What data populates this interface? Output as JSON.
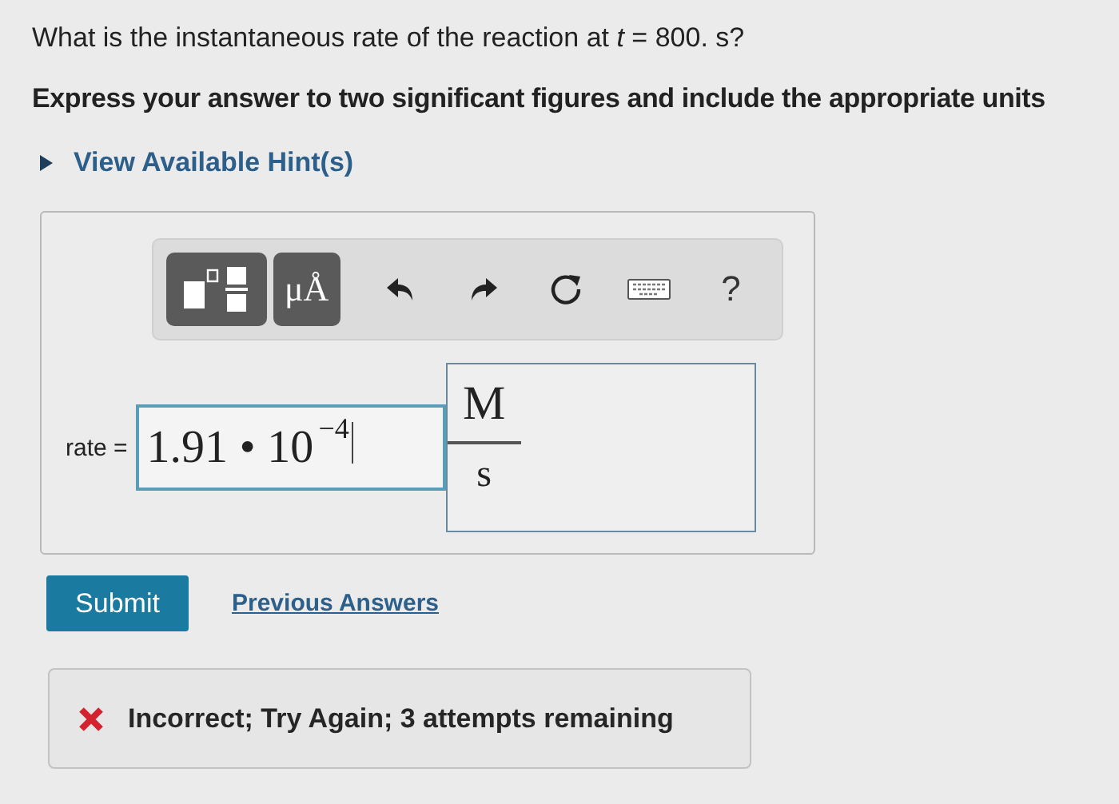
{
  "question": "What is the instantaneous rate of the reaction at *t* = 800. s?",
  "instruction": "Express your answer to two significant figures and include the appropriate units",
  "hint_link": {
    "label": "View Available Hint(s)",
    "expanded": false
  },
  "toolbar": [
    {
      "kind": "templates"
    },
    {
      "kind": "text",
      "label": "μÅ"
    },
    {
      "kind": "undo"
    },
    {
      "kind": "redo"
    },
    {
      "kind": "reset"
    },
    {
      "kind": "keyboard"
    },
    {
      "kind": "help",
      "label": "?"
    }
  ],
  "answer": {
    "label": "rate =",
    "value": "1.91 • 10$^{−4}$",
    "units_numerator": "M",
    "units_denominator": "s"
  },
  "buttons": {
    "submit": "Submit",
    "previous": "Previous Answers"
  },
  "feedback": {
    "correct": false,
    "message": "Incorrect; Try Again; 3 attempts remaining"
  }
}
